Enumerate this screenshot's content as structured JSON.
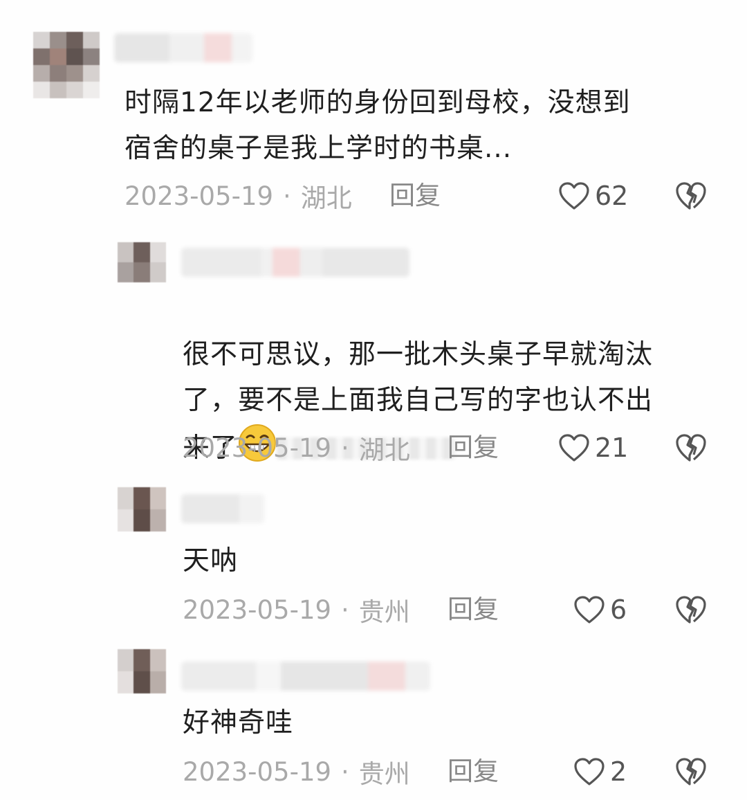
{
  "comments": [
    {
      "text": "时隔12年以老师的身份回到母校，没想到\n宿舍的桌子是我上学时的书桌...",
      "date": "2023-05-19",
      "location": "湖北",
      "reply_label": "回复",
      "likes": "62"
    },
    {
      "text": "很不可思议，那一批木头桌子早就淘汰\n了，要不是上面我自己写的字也认不出\n来了",
      "date": "2023-05-19",
      "location": "湖北",
      "reply_label": "回复",
      "likes": "21"
    },
    {
      "text": "天呐",
      "date": "2023-05-19",
      "location": "贵州",
      "reply_label": "回复",
      "likes": "6"
    },
    {
      "text": "好神奇哇",
      "date": "2023-05-19",
      "location": "贵州",
      "reply_label": "回复",
      "likes": "2"
    }
  ],
  "separator": "·",
  "icons": {
    "like": "heart-outline-icon",
    "dislike": "broken-heart-icon",
    "emoji": "grinning-face-icon"
  },
  "colors": {
    "meta_text": "#a9a9a9",
    "body_text": "#1f1f1f",
    "icon_stroke": "#555555"
  }
}
